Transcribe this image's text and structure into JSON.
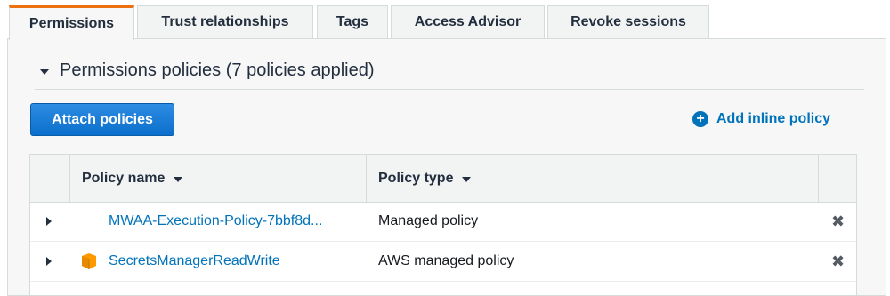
{
  "tabs": [
    {
      "label": "Permissions",
      "active": true
    },
    {
      "label": "Trust relationships",
      "active": false
    },
    {
      "label": "Tags",
      "active": false
    },
    {
      "label": "Access Advisor",
      "active": false
    },
    {
      "label": "Revoke sessions",
      "active": false
    }
  ],
  "section": {
    "title": "Permissions policies (7 policies applied)"
  },
  "actions": {
    "attach_label": "Attach policies",
    "inline_label": "Add inline policy"
  },
  "table": {
    "columns": [
      "Policy name",
      "Policy type"
    ],
    "rows": [
      {
        "name": "MWAA-Execution-Policy-7bbf8d...",
        "type": "Managed policy",
        "icon": "none"
      },
      {
        "name": "SecretsManagerReadWrite",
        "type": "AWS managed policy",
        "icon": "aws-managed-cube-icon"
      }
    ]
  },
  "colors": {
    "accent_tab": "#ec7211",
    "link": "#0073bb",
    "primary_button": "#0b6fcb",
    "aws_icon": "#ff9900"
  }
}
